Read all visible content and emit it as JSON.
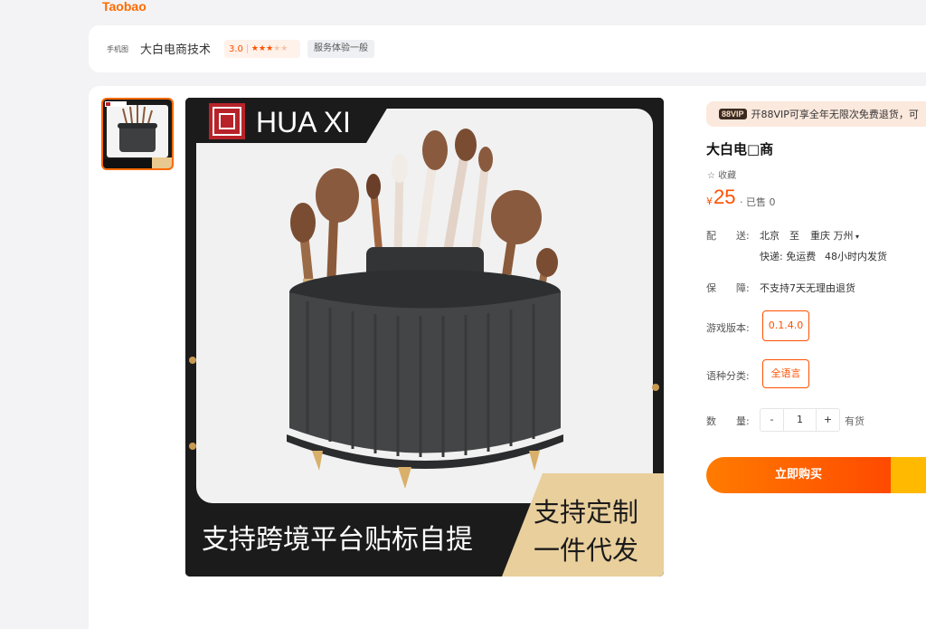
{
  "brand": {
    "logo_text": "Taobao"
  },
  "shop": {
    "type_label": "手机图",
    "name": "大白电商技术",
    "rating": "3.0",
    "rating_stars": 3,
    "service_badge": "服务体验一般"
  },
  "gallery": {
    "image_banner_brand": "HUA XI",
    "image_banner_left": "支持跨境平台贴标自提",
    "image_banner_right_line1": "支持定制",
    "image_banner_right_line2": "一件代发"
  },
  "product": {
    "vip_badge": "88VIP",
    "vip_text": "开88VIP可享全年无限次免费退货，可",
    "title": "大白电□商",
    "favorite": "收藏",
    "price_symbol": "¥",
    "price": "25",
    "sold": "· 已售 0"
  },
  "delivery": {
    "label": "配　　送:",
    "from": "北京",
    "to_word": "至",
    "destination": "重庆 万州",
    "shipping": "快递: 免运费",
    "dispatch": "48小时内发货"
  },
  "guarantee": {
    "label": "保　　障:",
    "value": "不支持7天无理由退货"
  },
  "options": {
    "version_label": "游戏版本:",
    "version_value": "0.1.4.0",
    "language_label": "语种分类:",
    "language_value": "全语言"
  },
  "quantity": {
    "label": "数　　量:",
    "minus": "-",
    "value": "1",
    "plus": "+",
    "stock": "有货"
  },
  "actions": {
    "buy_now": "立即购买"
  },
  "colors": {
    "accent": "#ff5000",
    "brand": "#ff6a00",
    "cart": "#ffb900"
  }
}
